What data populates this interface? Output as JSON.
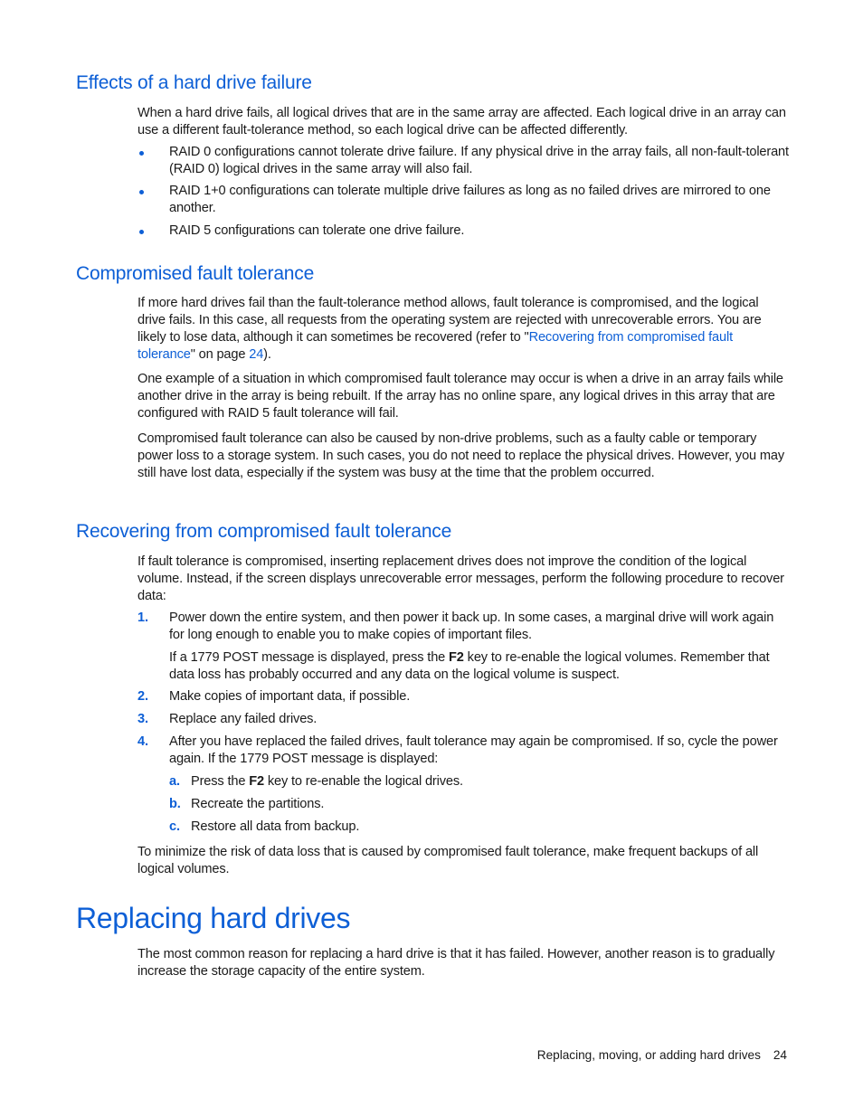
{
  "sections": {
    "effects": {
      "heading": "Effects of a hard drive failure",
      "intro": "When a hard drive fails, all logical drives that are in the same array are affected. Each logical drive in an array can use a different fault-tolerance method, so each logical drive can be affected differently.",
      "bullets": [
        "RAID 0 configurations cannot tolerate drive failure. If any physical drive in the array fails, all non-fault-tolerant (RAID 0) logical drives in the same array will also fail.",
        "RAID 1+0 configurations can tolerate multiple drive failures as long as no failed drives are mirrored to one another.",
        "RAID 5 configurations can tolerate one drive failure."
      ]
    },
    "compromised": {
      "heading": "Compromised fault tolerance",
      "p1_before": "If more hard drives fail than the fault-tolerance method allows, fault tolerance is compromised, and the logical drive fails. In this case, all requests from the operating system are rejected with unrecoverable errors. You are likely to lose data, although it can sometimes be recovered (refer to \"",
      "p1_link": "Recovering from compromised fault tolerance",
      "p1_middle": "\" on page ",
      "p1_page_link": "24",
      "p1_after": ").",
      "p2": "One example of a situation in which compromised fault tolerance may occur is when a drive in an array fails while another drive in the array is being rebuilt. If the array has no online spare, any logical drives in this array that are configured with RAID 5 fault tolerance will fail.",
      "p3": "Compromised fault tolerance can also be caused by non-drive problems, such as a faulty cable or temporary power loss to a storage system. In such cases, you do not need to replace the physical drives. However, you may still have lost data, especially if the system was busy at the time that the problem occurred."
    },
    "recovering": {
      "heading": "Recovering from compromised fault tolerance",
      "intro": "If fault tolerance is compromised, inserting replacement drives does not improve the condition of the logical volume. Instead, if the screen displays unrecoverable error messages, perform the following procedure to recover data:",
      "steps": [
        {
          "num": "1.",
          "text": "Power down the entire system, and then power it back up. In some cases, a marginal drive will work again for long enough to enable you to make copies of important files."
        },
        {
          "num": "2.",
          "text": "Make copies of important data, if possible."
        },
        {
          "num": "3.",
          "text": "Replace any failed drives."
        },
        {
          "num": "4.",
          "text": "After you have replaced the failed drives, fault tolerance may again be compromised. If so, cycle the power again. If the 1779 POST message is displayed:"
        }
      ],
      "step1_note_before": "If a 1779 POST message is displayed, press the ",
      "step1_note_key": "F2",
      "step1_note_after": " key to re-enable the logical volumes. Remember that data loss has probably occurred and any data on the logical volume is suspect.",
      "substeps": [
        {
          "letter": "a.",
          "before": "Press the ",
          "key": "F2",
          "after": " key to re-enable the logical drives."
        },
        {
          "letter": "b.",
          "text": "Recreate the partitions."
        },
        {
          "letter": "c.",
          "text": "Restore all data from backup."
        }
      ],
      "closing": "To minimize the risk of data loss that is caused by compromised fault tolerance, make frequent backups of all logical volumes."
    },
    "replacing": {
      "heading": "Replacing hard drives",
      "intro": "The most common reason for replacing a hard drive is that it has failed. However, another reason is to gradually increase the storage capacity of the entire system."
    }
  },
  "footer": {
    "chapter_title": "Replacing, moving, or adding hard drives",
    "page_number": "24"
  },
  "colors": {
    "heading_blue": "#0d5fd6",
    "text": "#1a1a1a"
  }
}
